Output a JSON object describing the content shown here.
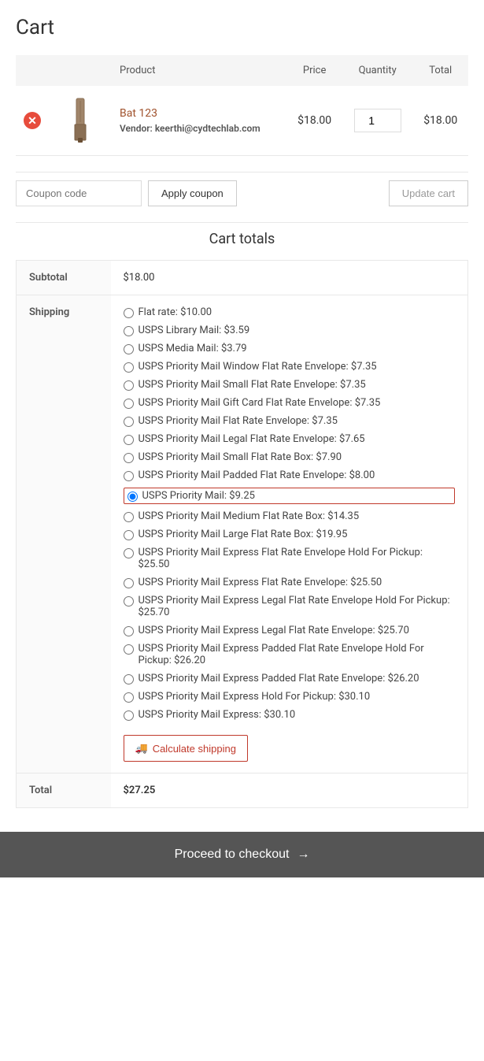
{
  "page": {
    "title": "Cart"
  },
  "table": {
    "headers": {
      "product": "Product",
      "price": "Price",
      "quantity": "Quantity",
      "total": "Total"
    }
  },
  "cart_item": {
    "name": "Bat 123",
    "vendor_label": "Vendor:",
    "vendor_email": "keerthi@cydtechlab.com",
    "price": "$18.00",
    "quantity": "1",
    "total": "$18.00"
  },
  "coupon": {
    "placeholder": "Coupon code",
    "apply_label": "Apply coupon",
    "update_label": "Update cart"
  },
  "cart_totals": {
    "title": "Cart totals",
    "subtotal_label": "Subtotal",
    "subtotal_value": "$18.00",
    "shipping_label": "Shipping",
    "total_label": "Total",
    "total_value": "$27.25"
  },
  "shipping_options": [
    {
      "id": "flat_rate",
      "label": "Flat rate: $10.00",
      "selected": false
    },
    {
      "id": "usps_library",
      "label": "USPS Library Mail: $3.59",
      "selected": false
    },
    {
      "id": "usps_media",
      "label": "USPS Media Mail: $3.79",
      "selected": false
    },
    {
      "id": "usps_priority_window",
      "label": "USPS Priority Mail Window Flat Rate Envelope: $7.35",
      "selected": false
    },
    {
      "id": "usps_priority_small_envelope",
      "label": "USPS Priority Mail Small Flat Rate Envelope: $7.35",
      "selected": false
    },
    {
      "id": "usps_priority_gift_card",
      "label": "USPS Priority Mail Gift Card Flat Rate Envelope: $7.35",
      "selected": false
    },
    {
      "id": "usps_priority_flat_rate_envelope",
      "label": "USPS Priority Mail Flat Rate Envelope: $7.35",
      "selected": false
    },
    {
      "id": "usps_priority_legal",
      "label": "USPS Priority Mail Legal Flat Rate Envelope: $7.65",
      "selected": false
    },
    {
      "id": "usps_priority_small_box",
      "label": "USPS Priority Mail Small Flat Rate Box: $7.90",
      "selected": false
    },
    {
      "id": "usps_priority_padded_envelope",
      "label": "USPS Priority Mail Padded Flat Rate Envelope: $8.00",
      "selected": false
    },
    {
      "id": "usps_priority_mail",
      "label": "USPS Priority Mail: $9.25",
      "selected": true
    },
    {
      "id": "usps_priority_medium_box",
      "label": "USPS Priority Mail Medium Flat Rate Box: $14.35",
      "selected": false
    },
    {
      "id": "usps_priority_large_box",
      "label": "USPS Priority Mail Large Flat Rate Box: $19.95",
      "selected": false
    },
    {
      "id": "usps_express_envelope_hold",
      "label": "USPS Priority Mail Express Flat Rate Envelope Hold For Pickup: $25.50",
      "selected": false
    },
    {
      "id": "usps_express_envelope",
      "label": "USPS Priority Mail Express Flat Rate Envelope: $25.50",
      "selected": false
    },
    {
      "id": "usps_express_legal_hold",
      "label": "USPS Priority Mail Express Legal Flat Rate Envelope Hold For Pickup: $25.70",
      "selected": false
    },
    {
      "id": "usps_express_legal",
      "label": "USPS Priority Mail Express Legal Flat Rate Envelope: $25.70",
      "selected": false
    },
    {
      "id": "usps_express_padded_hold",
      "label": "USPS Priority Mail Express Padded Flat Rate Envelope Hold For Pickup: $26.20",
      "selected": false
    },
    {
      "id": "usps_express_padded",
      "label": "USPS Priority Mail Express Padded Flat Rate Envelope: $26.20",
      "selected": false
    },
    {
      "id": "usps_express_hold",
      "label": "USPS Priority Mail Express Hold For Pickup: $30.10",
      "selected": false
    },
    {
      "id": "usps_express",
      "label": "USPS Priority Mail Express: $30.10",
      "selected": false
    }
  ],
  "calculate_shipping": {
    "label": "Calculate shipping",
    "icon": "🚚"
  },
  "checkout": {
    "label": "Proceed to checkout",
    "arrow": "→"
  }
}
